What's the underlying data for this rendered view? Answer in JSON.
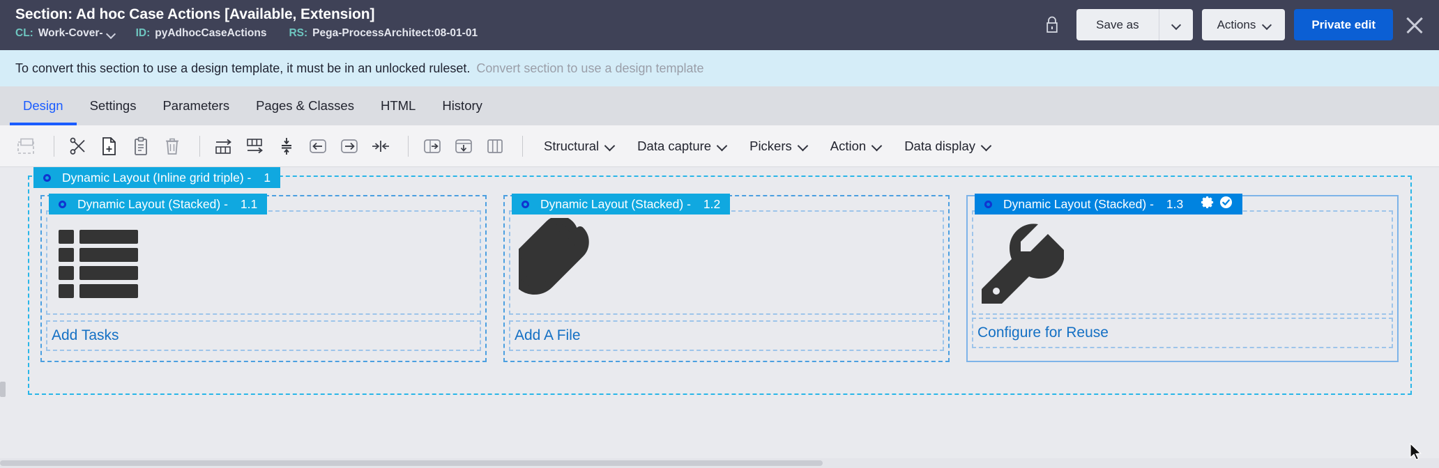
{
  "header": {
    "title": "Section: Ad hoc Case Actions [Available, Extension]",
    "meta": [
      {
        "key": "CL:",
        "value": "Work-Cover-",
        "has_caret": true
      },
      {
        "key": "ID:",
        "value": "pyAdhocCaseActions",
        "has_caret": false
      },
      {
        "key": "RS:",
        "value": "Pega-ProcessArchitect:08-01-01",
        "has_caret": false
      }
    ],
    "lock_icon": "lock-icon",
    "save_as_label": "Save as",
    "save_as_caret_icon": "chevron-down-icon",
    "actions_label": "Actions",
    "actions_caret_icon": "chevron-down-icon",
    "private_edit_label": "Private edit",
    "close_icon": "close-icon",
    "bg_color": "#3f4257",
    "accent_color": "#0b5fd4",
    "key_color": "#6ec6c0"
  },
  "banner": {
    "message": "To convert this section to use a design template, it must be in an unlocked ruleset.",
    "link": "Convert section to use a design template",
    "bg_color": "#d5edf8"
  },
  "tabs": {
    "items": [
      {
        "label": "Design",
        "active": true
      },
      {
        "label": "Settings",
        "active": false
      },
      {
        "label": "Parameters",
        "active": false
      },
      {
        "label": "Pages & Classes",
        "active": false
      },
      {
        "label": "HTML",
        "active": false
      },
      {
        "label": "History",
        "active": false
      }
    ],
    "active_color": "#1a5cff"
  },
  "toolbar": {
    "icons": [
      "select-all-icon",
      "cut-icon",
      "copy-new-icon",
      "paste-icon",
      "delete-icon",
      "insert-row-after-icon",
      "insert-column-after-icon",
      "distribute-vertical-icon",
      "move-left-icon",
      "move-right-icon",
      "merge-cells-icon",
      "split-right-icon",
      "split-down-icon",
      "split-columns-icon"
    ],
    "menus": [
      {
        "label": "Structural",
        "caret": "chevron-down-icon"
      },
      {
        "label": "Data capture",
        "caret": "chevron-down-icon"
      },
      {
        "label": "Pickers",
        "caret": "chevron-down-icon"
      },
      {
        "label": "Action",
        "caret": "chevron-down-icon"
      },
      {
        "label": "Data display",
        "caret": "chevron-down-icon"
      }
    ]
  },
  "canvas": {
    "outer": {
      "label_prefix": "Dynamic Layout (Inline grid triple) -",
      "number": "1",
      "color": "#10a8e0"
    },
    "panels": [
      {
        "label_prefix": "Dynamic Layout (Stacked) -",
        "number": "1.1",
        "color": "#10a8e0",
        "selected": false,
        "icon": "task-list-icon",
        "link": "Add Tasks",
        "header_icons": []
      },
      {
        "label_prefix": "Dynamic Layout (Stacked) -",
        "number": "1.2",
        "color": "#10a8e0",
        "selected": false,
        "icon": "paperclip-icon",
        "link": "Add A File",
        "header_icons": []
      },
      {
        "label_prefix": "Dynamic Layout (Stacked) -",
        "number": "1.3",
        "color": "#0083e0",
        "selected": true,
        "icon": "wrench-icon",
        "link": "Configure for Reuse",
        "header_icons": [
          "gear-icon",
          "check-circle-icon"
        ]
      }
    ],
    "link_color": "#1470c4"
  }
}
